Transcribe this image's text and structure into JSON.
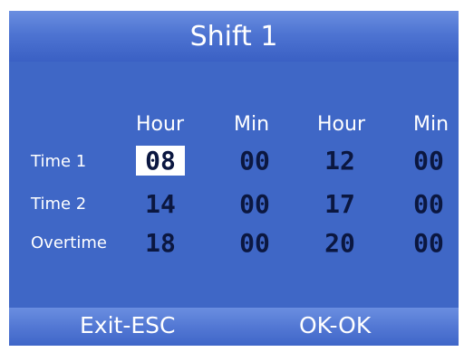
{
  "title": "Shift 1",
  "headers": [
    "Hour",
    "Min",
    "Hour",
    "Min"
  ],
  "rows": [
    {
      "label": "Time 1",
      "values": [
        "08",
        "00",
        "12",
        "00"
      ]
    },
    {
      "label": "Time 2",
      "values": [
        "14",
        "00",
        "17",
        "00"
      ]
    },
    {
      "label": "Overtime",
      "values": [
        "18",
        "00",
        "20",
        "00"
      ]
    }
  ],
  "selected": {
    "row": 0,
    "column": 0
  },
  "footer": {
    "exit": "Exit-ESC",
    "ok": "OK-OK"
  },
  "colors": {
    "panel": "#3f67c6",
    "value_text": "#0b1740",
    "label_text": "#ffffff"
  }
}
